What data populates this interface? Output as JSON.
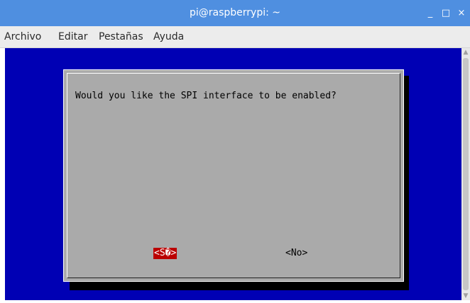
{
  "window": {
    "title": "pi@raspberrypi: ~",
    "controls": {
      "minimize": "_",
      "maximize": "□",
      "close": "×"
    }
  },
  "menu": {
    "items": [
      "Archivo",
      "Editar",
      "Pestañas",
      "Ayuda"
    ]
  },
  "dialog": {
    "question": "Would you like the SPI interface to be enabled?",
    "yes_label": "<S�>",
    "no_label": "<No>"
  },
  "scrollbar": {
    "up_icon": "▲",
    "down_icon": "▼"
  },
  "colors": {
    "titlebar": "#4f8fe0",
    "terminal_bg": "#0000b4",
    "dialog_bg": "#aaaaaa",
    "selected_button": "#bb0000"
  }
}
